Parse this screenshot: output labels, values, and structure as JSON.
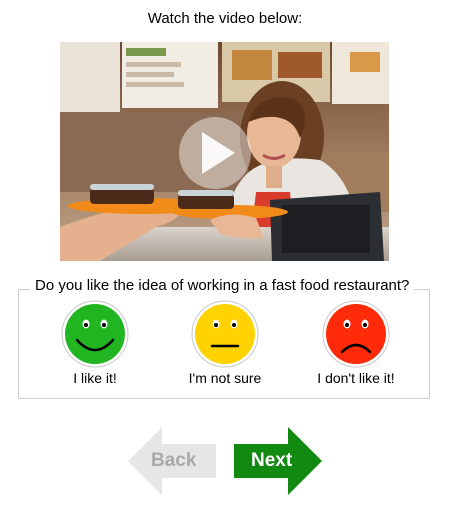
{
  "instruction": "Watch the video below:",
  "video": {
    "play_icon": "play-icon"
  },
  "question": "Do you like the idea of working in a fast food restaurant?",
  "options": [
    {
      "label": "I like it!",
      "icon": "happy-face-icon",
      "color": "#22b522"
    },
    {
      "label": "I'm not sure",
      "icon": "neutral-face-icon",
      "color": "#ffd200"
    },
    {
      "label": "I don't like it!",
      "icon": "sad-face-icon",
      "color": "#ff2a0a"
    }
  ],
  "navigation": {
    "back_label": "Back",
    "back_color": "#e6e6e6",
    "back_text_color": "#a9a9a9",
    "next_label": "Next",
    "next_color": "#128a12",
    "next_text_color": "#ffffff"
  }
}
